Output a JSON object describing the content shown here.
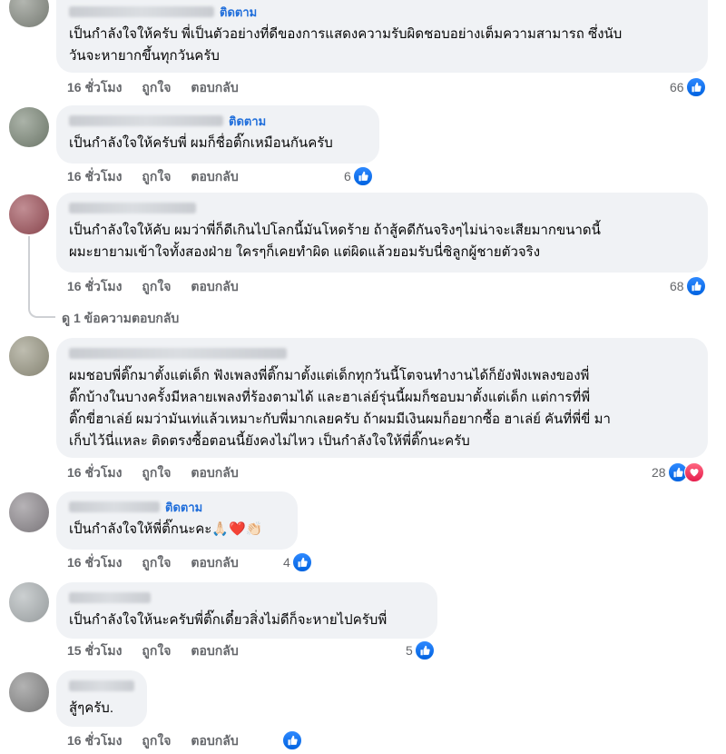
{
  "comments": [
    {
      "follow_label": "ติดตาม",
      "lines": [
        "เป็นกำลังใจให้ครับ พี่เป็นตัวอย่างที่ดีของการแสดงความรับผิดชอบอย่างเต็มความสามารถ ซึ่งนับ",
        "วันจะหายากขึ้นทุกวันครับ"
      ],
      "time": "16 ชั่วโมง",
      "like_label": "ถูกใจ",
      "reply_label": "ตอบกลับ",
      "reactions": [
        "like"
      ],
      "reaction_count": "66",
      "avatar_color": "#8a8f86"
    },
    {
      "follow_label": "ติดตาม",
      "lines": [
        "เป็นกำลังใจให้ครับพี่ ผมก็ชื่อติ๊กเหมือนกันครับ"
      ],
      "time": "16 ชั่วโมง",
      "like_label": "ถูกใจ",
      "reply_label": "ตอบกลับ",
      "reactions": [
        "like"
      ],
      "reaction_count": "6",
      "avatar_color": "#7e8a7a"
    },
    {
      "follow_label": "",
      "lines": [
        "เป็นกำลังใจให้คับ ผมว่าพี่ก็ดีเกินไปโลกนี้มันโหดร้าย ถ้าสู้คดีกันจริงๆไม่น่าจะเสียมากขนาดนี้",
        "ผมะยายามเข้าใจทั้งสองฝ่าย ใครๆก็เคยทำผิด แต่ผิดแล้วยอมรับนี่ซิลูกผู้ชายตัวจริง"
      ],
      "time": "16 ชั่วโมง",
      "like_label": "ถูกใจ",
      "reply_label": "ตอบกลับ",
      "reactions": [
        "like"
      ],
      "reaction_count": "68",
      "avatar_color": "#a0515a",
      "view_replies": "ดู 1 ข้อความตอบกลับ"
    },
    {
      "follow_label": "",
      "lines": [
        "ผมชอบพี่ติ๊กมาตั้งแต่เด็ก ฟังเพลงพี่ติ๊กมาตั้งแต่เด็กทุกวันนี้โตจนทำงานได้ก็ยังฟังเพลงของพี่",
        "ติ๊กบ้างในบางครั้งมีหลายเพลงที่ร้องตามได้ และฮาเล่ย์รุ่นนี้ผมก็ชอบมาตั้งแต่เด็ก แต่การที่พี่",
        "ติ๊กขี่ฮาเล่ย์ ผมว่ามันเท่แล้วเหมาะกับพี่มากเลยครับ ถ้าผมมีเงินผมก็อยากซื้อ ฮาเล่ย์ คันที่พี่ขี่ มา",
        "เก็บไว้นี่แหละ ติดตรงซื้อตอนนี้ยังคงไม่ไหว เป็นกำลังใจให้พี่ติ๊กนะครับ"
      ],
      "time": "16 ชั่วโมง",
      "like_label": "ถูกใจ",
      "reply_label": "ตอบกลับ",
      "reactions": [
        "like",
        "love"
      ],
      "reaction_count": "28",
      "avatar_color": "#9c9a86"
    },
    {
      "follow_label": "ติดตาม",
      "lines": [
        "เป็นกำลังใจให้พี่ติ๊กนะคะ🙏🏻❤️👏🏻"
      ],
      "time": "16 ชั่วโมง",
      "like_label": "ถูกใจ",
      "reply_label": "ตอบกลับ",
      "reactions": [
        "like"
      ],
      "reaction_count": "4",
      "avatar_color": "#8f8a8f"
    },
    {
      "follow_label": "",
      "lines": [
        "เป็นกำลังใจให้นะครับพี่ติ๊กเดี๋ยวสิ่งไม่ดีก็จะหายไปครับพี่"
      ],
      "time": "15 ชั่วโมง",
      "like_label": "ถูกใจ",
      "reply_label": "ตอบกลับ",
      "reactions": [
        "like"
      ],
      "reaction_count": "5",
      "avatar_color": "#b0b6b8"
    },
    {
      "follow_label": "",
      "lines": [
        "สู้ๆครับ."
      ],
      "time": "16 ชั่วโมง",
      "like_label": "ถูกใจ",
      "reply_label": "ตอบกลับ",
      "reactions": [
        "like"
      ],
      "reaction_count": "",
      "avatar_color": "#8a8a8a"
    }
  ],
  "colors": {
    "like_blue": "#1877f2",
    "love_red": "#e61e4d",
    "follow_blue": "#216fdb",
    "bubble_bg": "#f0f2f5",
    "meta_gray": "#65676b"
  }
}
